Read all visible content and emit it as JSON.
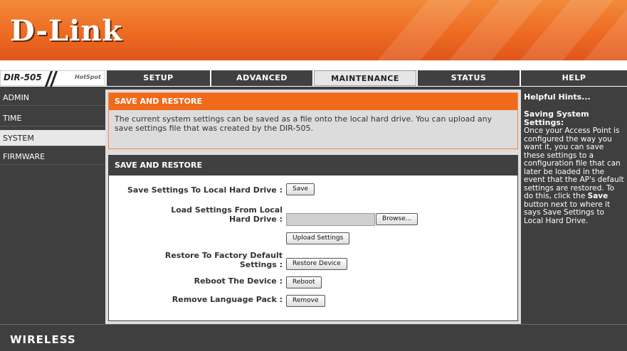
{
  "brand": {
    "logo": "D-Link",
    "model": "DIR-505",
    "hotspot": "HotSpot",
    "accent": "#f06a1c",
    "dark": "#404040"
  },
  "nav": {
    "tabs": [
      {
        "label": "SETUP"
      },
      {
        "label": "ADVANCED"
      },
      {
        "label": "MAINTENANCE"
      },
      {
        "label": "STATUS"
      },
      {
        "label": "HELP"
      }
    ],
    "active": "MAINTENANCE"
  },
  "sidebar": {
    "items": [
      {
        "label": "ADMIN"
      },
      {
        "label": "TIME"
      },
      {
        "label": "SYSTEM"
      },
      {
        "label": "FIRMWARE"
      }
    ],
    "active": "SYSTEM"
  },
  "intro": {
    "title": "SAVE AND RESTORE",
    "text": "The current system settings can be saved as a file onto the local hard drive. You can upload any save settings file that was created by the DIR-505."
  },
  "form": {
    "title": "SAVE AND RESTORE",
    "save_label": "Save Settings To Local Hard Drive :",
    "save_btn": "Save",
    "load_label": "Load Settings From Local Hard Drive :",
    "browse_btn": "Browse...",
    "upload_btn": "Upload Settings",
    "restore_label": "Restore To Factory Default Settings :",
    "restore_btn": "Restore Device",
    "reboot_label": "Reboot The Device :",
    "reboot_btn": "Reboot",
    "lang_label": "Remove Language Pack :",
    "lang_btn": "Remove"
  },
  "help": {
    "title": "Helpful Hints...",
    "subtitle": "Saving System Settings:",
    "body_before": "Once your Access Point is configured the way you want it, you can save these settings to a configuration file that can later be loaded in the event that the AP's default settings are restored. To do this, click the",
    "body_bold": "Save",
    "body_after": "button next to where it says Save Settings to Local Hard Drive."
  },
  "footer": {
    "label": "WIRELESS"
  }
}
